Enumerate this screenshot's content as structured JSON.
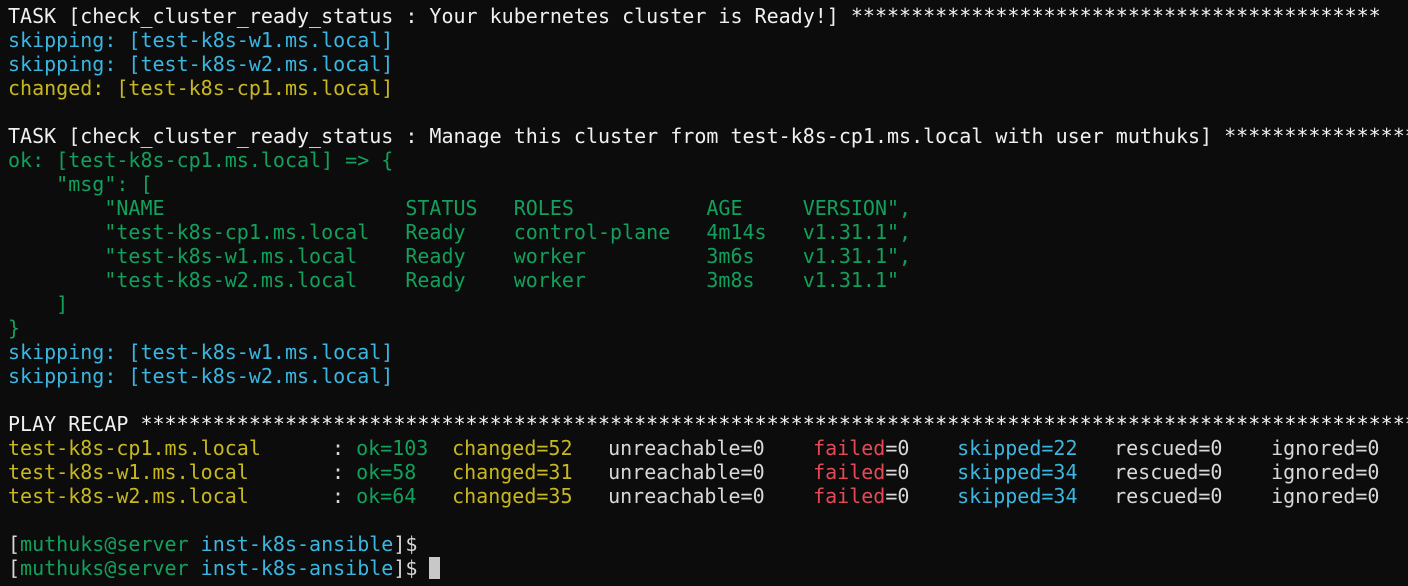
{
  "task1": {
    "header": "TASK [check_cluster_ready_status : Your kubernetes cluster is Ready!] ********************************************",
    "lines": [
      {
        "text": "skipping: [test-k8s-w1.ms.local]",
        "color": "cyan"
      },
      {
        "text": "skipping: [test-k8s-w2.ms.local]",
        "color": "cyan"
      },
      {
        "text": "changed: [test-k8s-cp1.ms.local]",
        "color": "yellow"
      }
    ]
  },
  "task2": {
    "header": "TASK [check_cluster_ready_status : Manage this cluster from test-k8s-cp1.ms.local with user muthuks] *****************",
    "ok_line": "ok: [test-k8s-cp1.ms.local] => {",
    "msg_open": "    \"msg\": [",
    "table": [
      "        \"NAME                    STATUS   ROLES           AGE     VERSION\",",
      "        \"test-k8s-cp1.ms.local   Ready    control-plane   4m14s   v1.31.1\",",
      "        \"test-k8s-w1.ms.local    Ready    worker          3m6s    v1.31.1\",",
      "        \"test-k8s-w2.ms.local    Ready    worker          3m8s    v1.31.1\""
    ],
    "msg_close": "    ]",
    "brace_close": "}",
    "after": [
      "skipping: [test-k8s-w1.ms.local]",
      "skipping: [test-k8s-w2.ms.local]"
    ]
  },
  "recap": {
    "header": "PLAY RECAP ***************************************************************************************************************",
    "rows": [
      {
        "host": "test-k8s-cp1.ms.local      ",
        "sep": ": ",
        "ok": "ok=103",
        "changed": "changed=52",
        "unreachable": "unreachable=0",
        "failed_label": "failed",
        "failed_value": "=0",
        "skipped": "skipped=22",
        "rescued": "rescued=0",
        "ignored": "ignored=0"
      },
      {
        "host": "test-k8s-w1.ms.local       ",
        "sep": ": ",
        "ok": "ok=58",
        "changed": "changed=31",
        "unreachable": "unreachable=0",
        "failed_label": "failed",
        "failed_value": "=0",
        "skipped": "skipped=34",
        "rescued": "rescued=0",
        "ignored": "ignored=0"
      },
      {
        "host": "test-k8s-w2.ms.local       ",
        "sep": ": ",
        "ok": "ok=64",
        "changed": "changed=35",
        "unreachable": "unreachable=0",
        "failed_label": "failed",
        "failed_value": "=0",
        "skipped": "skipped=34",
        "rescued": "rescued=0",
        "ignored": "ignored=0"
      }
    ]
  },
  "prompts": [
    {
      "open": "[",
      "user": "muthuks@server",
      "dir": "inst-k8s-ansible",
      "close": "]$"
    },
    {
      "open": "[",
      "user": "muthuks@server",
      "dir": "inst-k8s-ansible",
      "close": "]$ "
    }
  ],
  "colors": {
    "background": "#0c0c0c",
    "cyan": "#3ab6e0",
    "yellow": "#c8b820",
    "green": "#13a05c",
    "red": "#e74856"
  }
}
